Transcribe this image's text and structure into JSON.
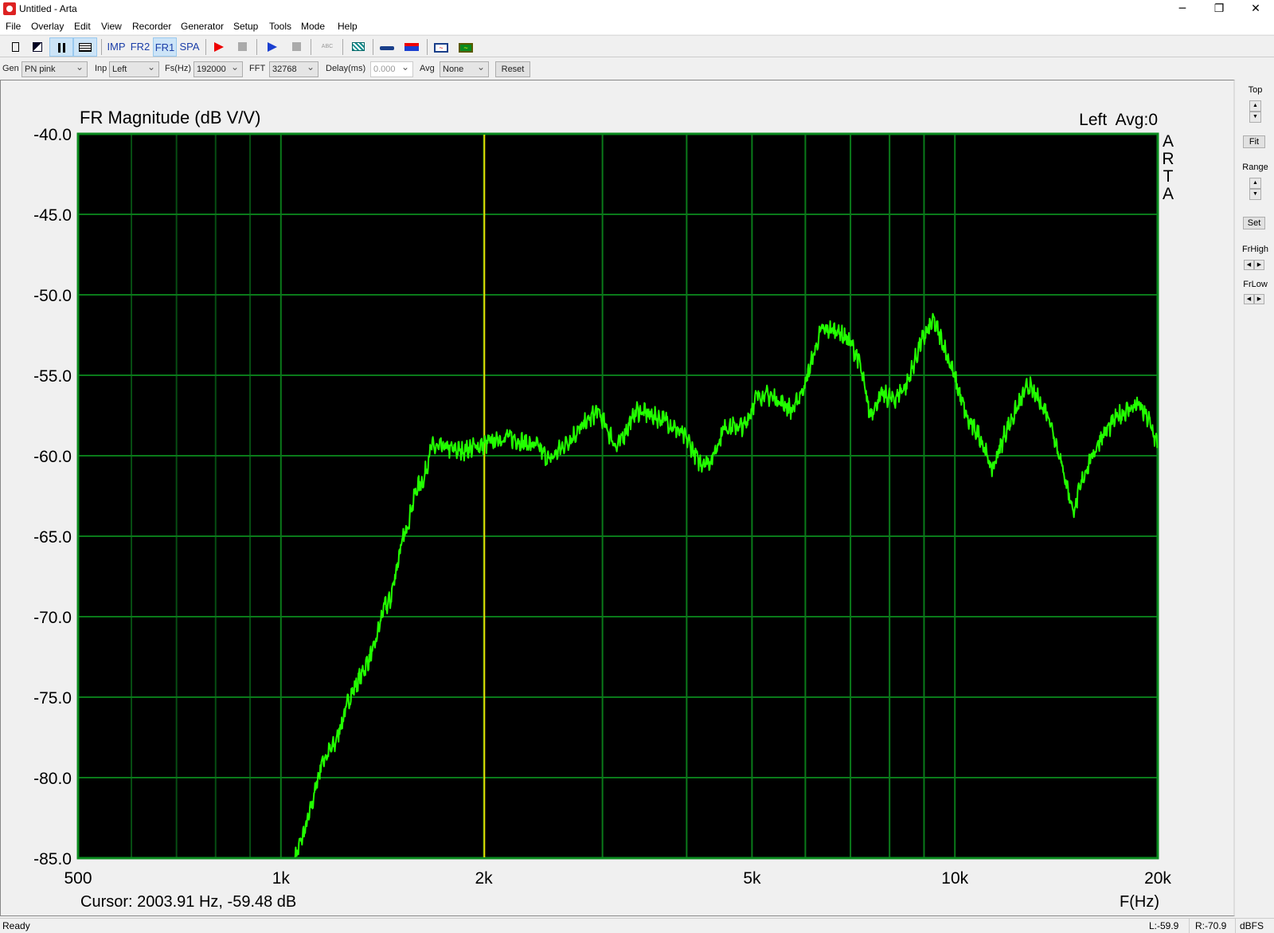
{
  "window": {
    "title": "Untitled - Arta",
    "minimize": "─",
    "restore": "❐",
    "close": "✕"
  },
  "menu": [
    "File",
    "Overlay",
    "Edit",
    "View",
    "Recorder",
    "Generator",
    "Setup",
    "Tools",
    "Mode",
    "Help"
  ],
  "toolbar": {
    "imp": "IMP",
    "fr2": "FR2",
    "fr1": "FR1",
    "spa": "SPA",
    "abc": "ABC"
  },
  "settings": {
    "gen_label": "Gen",
    "gen_value": "PN pink",
    "inp_label": "Inp",
    "inp_value": "Left",
    "fs_label": "Fs(Hz)",
    "fs_value": "192000",
    "fft_label": "FFT",
    "fft_value": "32768",
    "delay_label": "Delay(ms)",
    "delay_value": "0.000",
    "avg_label": "Avg",
    "avg_value": "None",
    "reset": "Reset"
  },
  "right_panel": {
    "top": "Top",
    "fit": "Fit",
    "range": "Range",
    "set": "Set",
    "frhigh": "FrHigh",
    "frlow": "FrLow"
  },
  "status": {
    "left": "Ready",
    "l_level": "L:-59.9",
    "r_level": "R:-70.9",
    "units": "dBFS"
  },
  "chart_data": {
    "type": "line",
    "title": "FR Magnitude (dB V/V)",
    "channel_info": "Left  Avg:0",
    "watermark": [
      "A",
      "R",
      "T",
      "A"
    ],
    "xlabel": "F(Hz)",
    "xscale": "log",
    "xlim": [
      500,
      20000
    ],
    "ylim": [
      -85,
      -40
    ],
    "yticks": [
      "-40.0",
      "-45.0",
      "-50.0",
      "-55.0",
      "-60.0",
      "-65.0",
      "-70.0",
      "-75.0",
      "-80.0",
      "-85.0"
    ],
    "xticks": [
      {
        "v": 500,
        "label": "500"
      },
      {
        "v": 1000,
        "label": "1k"
      },
      {
        "v": 2000,
        "label": "2k"
      },
      {
        "v": 5000,
        "label": "5k"
      },
      {
        "v": 10000,
        "label": "10k"
      },
      {
        "v": 20000,
        "label": "20k"
      }
    ],
    "cursor": {
      "freq": 2003.91,
      "db": -59.48,
      "text": "Cursor: 2003.91 Hz, -59.48 dB"
    },
    "colors": {
      "background": "#000000",
      "grid": "#0a8a1e",
      "trace": "#22ff00",
      "cursor": "#e8e000"
    },
    "series": [
      {
        "name": "Left",
        "points": [
          [
            1050,
            -85
          ],
          [
            1100,
            -82.5
          ],
          [
            1150,
            -79
          ],
          [
            1200,
            -78
          ],
          [
            1265,
            -75
          ],
          [
            1320,
            -73.5
          ],
          [
            1374,
            -72
          ],
          [
            1420,
            -69.5
          ],
          [
            1453,
            -69
          ],
          [
            1500,
            -66
          ],
          [
            1536,
            -64.5
          ],
          [
            1590,
            -62
          ],
          [
            1630,
            -61.5
          ],
          [
            1668,
            -59.5
          ],
          [
            1750,
            -59.5
          ],
          [
            1850,
            -59.7
          ],
          [
            2000,
            -59.3
          ],
          [
            2170,
            -58.8
          ],
          [
            2300,
            -59.2
          ],
          [
            2400,
            -59.4
          ],
          [
            2500,
            -60.3
          ],
          [
            2650,
            -59.2
          ],
          [
            2800,
            -58.2
          ],
          [
            2950,
            -57.2
          ],
          [
            3150,
            -59.5
          ],
          [
            3370,
            -57.2
          ],
          [
            3550,
            -57.5
          ],
          [
            3730,
            -57.8
          ],
          [
            4010,
            -59
          ],
          [
            4175,
            -60.4
          ],
          [
            4350,
            -60.3
          ],
          [
            4550,
            -58.2
          ],
          [
            4870,
            -58.2
          ],
          [
            5100,
            -56.2
          ],
          [
            5350,
            -56.3
          ],
          [
            5750,
            -57.2
          ],
          [
            6000,
            -55.5
          ],
          [
            6330,
            -52.2
          ],
          [
            6700,
            -52.2
          ],
          [
            7000,
            -53
          ],
          [
            7200,
            -54
          ],
          [
            7480,
            -57.4
          ],
          [
            7800,
            -56.2
          ],
          [
            8130,
            -56.5
          ],
          [
            8500,
            -55.5
          ],
          [
            8900,
            -53
          ],
          [
            9290,
            -51.6
          ],
          [
            9600,
            -53
          ],
          [
            10000,
            -55.2
          ],
          [
            10450,
            -57.8
          ],
          [
            10900,
            -58.8
          ],
          [
            11350,
            -60.9
          ],
          [
            11900,
            -58.5
          ],
          [
            12850,
            -55.6
          ],
          [
            13780,
            -57.5
          ],
          [
            14400,
            -60.5
          ],
          [
            14990,
            -63.5
          ],
          [
            15600,
            -61
          ],
          [
            16500,
            -58.8
          ],
          [
            17500,
            -57.5
          ],
          [
            18700,
            -56.8
          ],
          [
            19400,
            -57.8
          ],
          [
            20000,
            -59.4
          ]
        ]
      }
    ]
  }
}
